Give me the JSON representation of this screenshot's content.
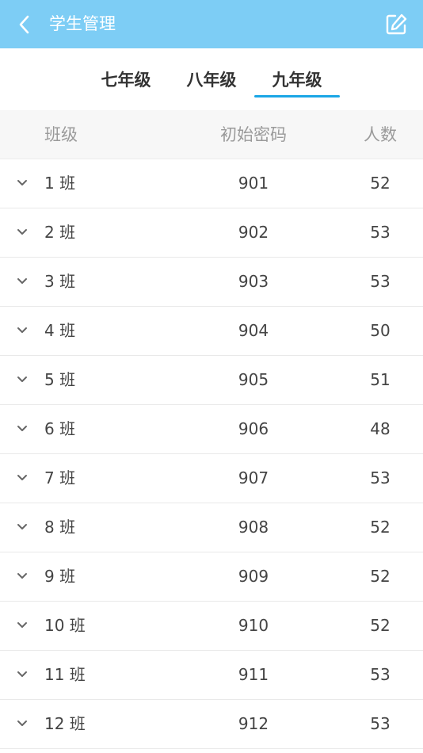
{
  "header": {
    "title": "学生管理",
    "back_icon": "chevron-left-icon",
    "edit_icon": "edit-icon",
    "bg_color": "#7dcdf5"
  },
  "tabs": [
    {
      "label": "七年级",
      "active": false
    },
    {
      "label": "八年级",
      "active": false
    },
    {
      "label": "九年级",
      "active": true
    }
  ],
  "accent_color": "#1aa6e6",
  "table": {
    "columns": [
      "班级",
      "初始密码",
      "人数"
    ],
    "rows": [
      {
        "class": "1 班",
        "password": "901",
        "count": "52"
      },
      {
        "class": "2 班",
        "password": "902",
        "count": "53"
      },
      {
        "class": "3 班",
        "password": "903",
        "count": "53"
      },
      {
        "class": "4 班",
        "password": "904",
        "count": "50"
      },
      {
        "class": "5 班",
        "password": "905",
        "count": "51"
      },
      {
        "class": "6 班",
        "password": "906",
        "count": "48"
      },
      {
        "class": "7 班",
        "password": "907",
        "count": "53"
      },
      {
        "class": "8 班",
        "password": "908",
        "count": "52"
      },
      {
        "class": "9 班",
        "password": "909",
        "count": "52"
      },
      {
        "class": "10 班",
        "password": "910",
        "count": "52"
      },
      {
        "class": "11 班",
        "password": "911",
        "count": "53"
      },
      {
        "class": "12 班",
        "password": "912",
        "count": "53"
      }
    ]
  }
}
